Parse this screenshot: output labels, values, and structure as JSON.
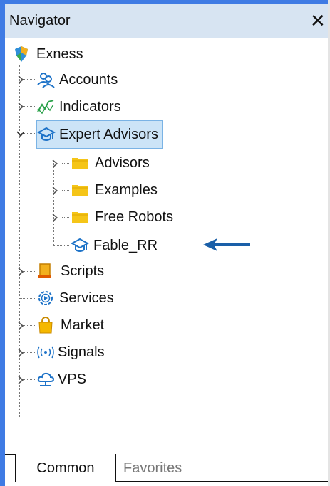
{
  "window": {
    "title": "Navigator",
    "close_label": "✕"
  },
  "tree": {
    "root": {
      "label": "Exness",
      "icon": "exness-logo-icon"
    },
    "items": [
      {
        "label": "Accounts",
        "icon": "accounts-icon",
        "expandable": true
      },
      {
        "label": "Indicators",
        "icon": "indicators-icon",
        "expandable": true
      },
      {
        "label": "Expert Advisors",
        "icon": "expert-advisors-icon",
        "expandable": true,
        "expanded": true,
        "selected": true,
        "children": [
          {
            "label": "Advisors",
            "icon": "folder-icon",
            "expandable": true
          },
          {
            "label": "Examples",
            "icon": "folder-icon",
            "expandable": true
          },
          {
            "label": "Free Robots",
            "icon": "folder-icon",
            "expandable": true
          },
          {
            "label": "Fable_RR",
            "icon": "expert-advisor-icon",
            "expandable": false
          }
        ]
      },
      {
        "label": "Scripts",
        "icon": "scripts-icon",
        "expandable": true
      },
      {
        "label": "Services",
        "icon": "services-icon",
        "expandable": false
      },
      {
        "label": "Market",
        "icon": "market-bag-icon",
        "expandable": true
      },
      {
        "label": "Signals",
        "icon": "signals-icon",
        "expandable": true
      },
      {
        "label": "VPS",
        "icon": "vps-cloud-icon",
        "expandable": true
      }
    ]
  },
  "tabs": [
    {
      "label": "Common",
      "active": true
    },
    {
      "label": "Favorites",
      "active": false
    }
  ],
  "colors": {
    "frame": "#3f7be4",
    "titlebar": "#d7e4f2",
    "selection": "#cce4f7",
    "folder": "#f5c518",
    "arrow": "#1a5fa8"
  }
}
